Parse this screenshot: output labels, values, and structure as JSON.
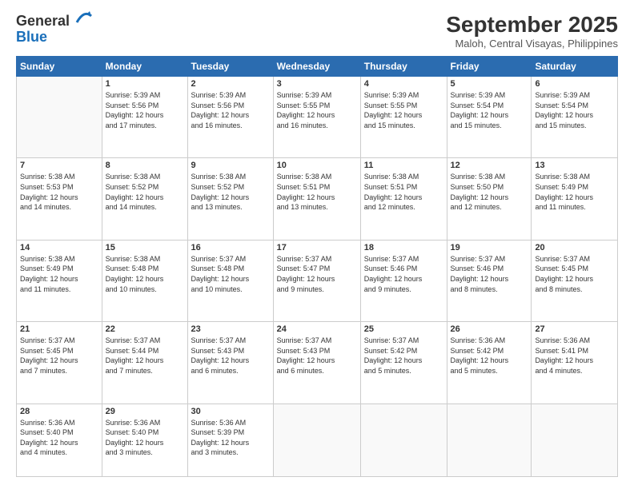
{
  "logo": {
    "general": "General",
    "blue": "Blue"
  },
  "header": {
    "title": "September 2025",
    "subtitle": "Maloh, Central Visayas, Philippines"
  },
  "weekdays": [
    "Sunday",
    "Monday",
    "Tuesday",
    "Wednesday",
    "Thursday",
    "Friday",
    "Saturday"
  ],
  "weeks": [
    [
      {
        "day": "",
        "info": ""
      },
      {
        "day": "1",
        "info": "Sunrise: 5:39 AM\nSunset: 5:56 PM\nDaylight: 12 hours\nand 17 minutes."
      },
      {
        "day": "2",
        "info": "Sunrise: 5:39 AM\nSunset: 5:56 PM\nDaylight: 12 hours\nand 16 minutes."
      },
      {
        "day": "3",
        "info": "Sunrise: 5:39 AM\nSunset: 5:55 PM\nDaylight: 12 hours\nand 16 minutes."
      },
      {
        "day": "4",
        "info": "Sunrise: 5:39 AM\nSunset: 5:55 PM\nDaylight: 12 hours\nand 15 minutes."
      },
      {
        "day": "5",
        "info": "Sunrise: 5:39 AM\nSunset: 5:54 PM\nDaylight: 12 hours\nand 15 minutes."
      },
      {
        "day": "6",
        "info": "Sunrise: 5:39 AM\nSunset: 5:54 PM\nDaylight: 12 hours\nand 15 minutes."
      }
    ],
    [
      {
        "day": "7",
        "info": "Sunrise: 5:38 AM\nSunset: 5:53 PM\nDaylight: 12 hours\nand 14 minutes."
      },
      {
        "day": "8",
        "info": "Sunrise: 5:38 AM\nSunset: 5:52 PM\nDaylight: 12 hours\nand 14 minutes."
      },
      {
        "day": "9",
        "info": "Sunrise: 5:38 AM\nSunset: 5:52 PM\nDaylight: 12 hours\nand 13 minutes."
      },
      {
        "day": "10",
        "info": "Sunrise: 5:38 AM\nSunset: 5:51 PM\nDaylight: 12 hours\nand 13 minutes."
      },
      {
        "day": "11",
        "info": "Sunrise: 5:38 AM\nSunset: 5:51 PM\nDaylight: 12 hours\nand 12 minutes."
      },
      {
        "day": "12",
        "info": "Sunrise: 5:38 AM\nSunset: 5:50 PM\nDaylight: 12 hours\nand 12 minutes."
      },
      {
        "day": "13",
        "info": "Sunrise: 5:38 AM\nSunset: 5:49 PM\nDaylight: 12 hours\nand 11 minutes."
      }
    ],
    [
      {
        "day": "14",
        "info": "Sunrise: 5:38 AM\nSunset: 5:49 PM\nDaylight: 12 hours\nand 11 minutes."
      },
      {
        "day": "15",
        "info": "Sunrise: 5:38 AM\nSunset: 5:48 PM\nDaylight: 12 hours\nand 10 minutes."
      },
      {
        "day": "16",
        "info": "Sunrise: 5:37 AM\nSunset: 5:48 PM\nDaylight: 12 hours\nand 10 minutes."
      },
      {
        "day": "17",
        "info": "Sunrise: 5:37 AM\nSunset: 5:47 PM\nDaylight: 12 hours\nand 9 minutes."
      },
      {
        "day": "18",
        "info": "Sunrise: 5:37 AM\nSunset: 5:46 PM\nDaylight: 12 hours\nand 9 minutes."
      },
      {
        "day": "19",
        "info": "Sunrise: 5:37 AM\nSunset: 5:46 PM\nDaylight: 12 hours\nand 8 minutes."
      },
      {
        "day": "20",
        "info": "Sunrise: 5:37 AM\nSunset: 5:45 PM\nDaylight: 12 hours\nand 8 minutes."
      }
    ],
    [
      {
        "day": "21",
        "info": "Sunrise: 5:37 AM\nSunset: 5:45 PM\nDaylight: 12 hours\nand 7 minutes."
      },
      {
        "day": "22",
        "info": "Sunrise: 5:37 AM\nSunset: 5:44 PM\nDaylight: 12 hours\nand 7 minutes."
      },
      {
        "day": "23",
        "info": "Sunrise: 5:37 AM\nSunset: 5:43 PM\nDaylight: 12 hours\nand 6 minutes."
      },
      {
        "day": "24",
        "info": "Sunrise: 5:37 AM\nSunset: 5:43 PM\nDaylight: 12 hours\nand 6 minutes."
      },
      {
        "day": "25",
        "info": "Sunrise: 5:37 AM\nSunset: 5:42 PM\nDaylight: 12 hours\nand 5 minutes."
      },
      {
        "day": "26",
        "info": "Sunrise: 5:36 AM\nSunset: 5:42 PM\nDaylight: 12 hours\nand 5 minutes."
      },
      {
        "day": "27",
        "info": "Sunrise: 5:36 AM\nSunset: 5:41 PM\nDaylight: 12 hours\nand 4 minutes."
      }
    ],
    [
      {
        "day": "28",
        "info": "Sunrise: 5:36 AM\nSunset: 5:40 PM\nDaylight: 12 hours\nand 4 minutes."
      },
      {
        "day": "29",
        "info": "Sunrise: 5:36 AM\nSunset: 5:40 PM\nDaylight: 12 hours\nand 3 minutes."
      },
      {
        "day": "30",
        "info": "Sunrise: 5:36 AM\nSunset: 5:39 PM\nDaylight: 12 hours\nand 3 minutes."
      },
      {
        "day": "",
        "info": ""
      },
      {
        "day": "",
        "info": ""
      },
      {
        "day": "",
        "info": ""
      },
      {
        "day": "",
        "info": ""
      }
    ]
  ]
}
